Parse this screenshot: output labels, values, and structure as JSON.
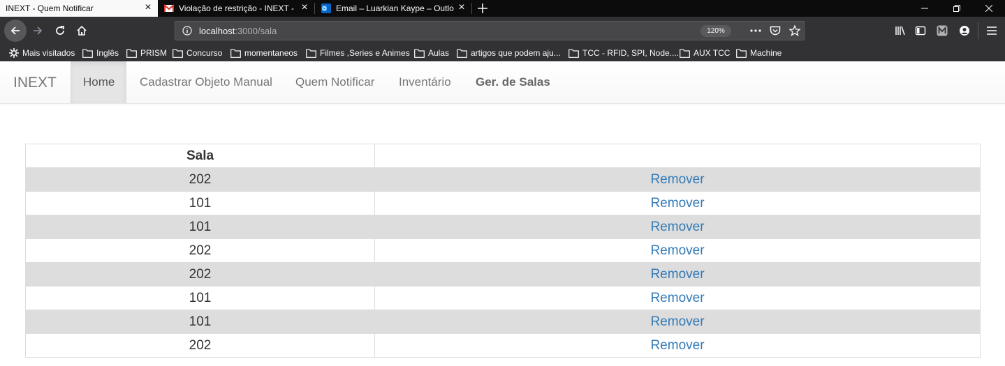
{
  "browser": {
    "tabs": [
      {
        "title": "INEXT - Quem Notificar",
        "favicon": "none",
        "active": true
      },
      {
        "title": "Violação de restrição - INEXT - ",
        "favicon": "gmail-icon",
        "active": false
      },
      {
        "title": "Email – Luarkian Kaype – Outlo",
        "favicon": "outlook-icon",
        "active": false
      }
    ],
    "url": {
      "host": "localhost",
      "rest": ":3000/sala"
    },
    "zoom": "120%",
    "bookmarks": [
      {
        "label": "Mais visitados",
        "icon": "gear-icon"
      },
      {
        "label": "Inglês",
        "icon": "folder-icon"
      },
      {
        "label": "PRISM",
        "icon": "folder-icon"
      },
      {
        "label": "Concurso",
        "icon": "folder-icon"
      },
      {
        "label": "momentaneos",
        "icon": "folder-icon"
      },
      {
        "label": "Filmes ,Series e Animes",
        "icon": "folder-icon"
      },
      {
        "label": "Aulas",
        "icon": "folder-icon"
      },
      {
        "label": "artigos que podem aju...",
        "icon": "folder-icon"
      },
      {
        "label": "TCC - RFID, SPI, Node....",
        "icon": "folder-icon"
      },
      {
        "label": "AUX TCC",
        "icon": "folder-icon"
      },
      {
        "label": "Machine",
        "icon": "folder-icon"
      }
    ]
  },
  "navbar": {
    "brand": "INEXT",
    "links": [
      {
        "label": "Home",
        "active": true
      },
      {
        "label": "Cadastrar Objeto Manual",
        "active": false
      },
      {
        "label": "Quem Notificar",
        "active": false
      },
      {
        "label": "Inventário",
        "active": false
      },
      {
        "label": "Ger. de Salas",
        "active": false,
        "bold": true
      }
    ]
  },
  "table": {
    "headers": [
      "Sala",
      ""
    ],
    "action_label": "Remover",
    "rows": [
      "202",
      "101",
      "101",
      "202",
      "202",
      "101",
      "101",
      "202"
    ]
  },
  "colors": {
    "link": "#337ab7",
    "stripe": "#dddddd",
    "chrome_dark": "#0c0c0d",
    "toolbar": "#323234"
  }
}
